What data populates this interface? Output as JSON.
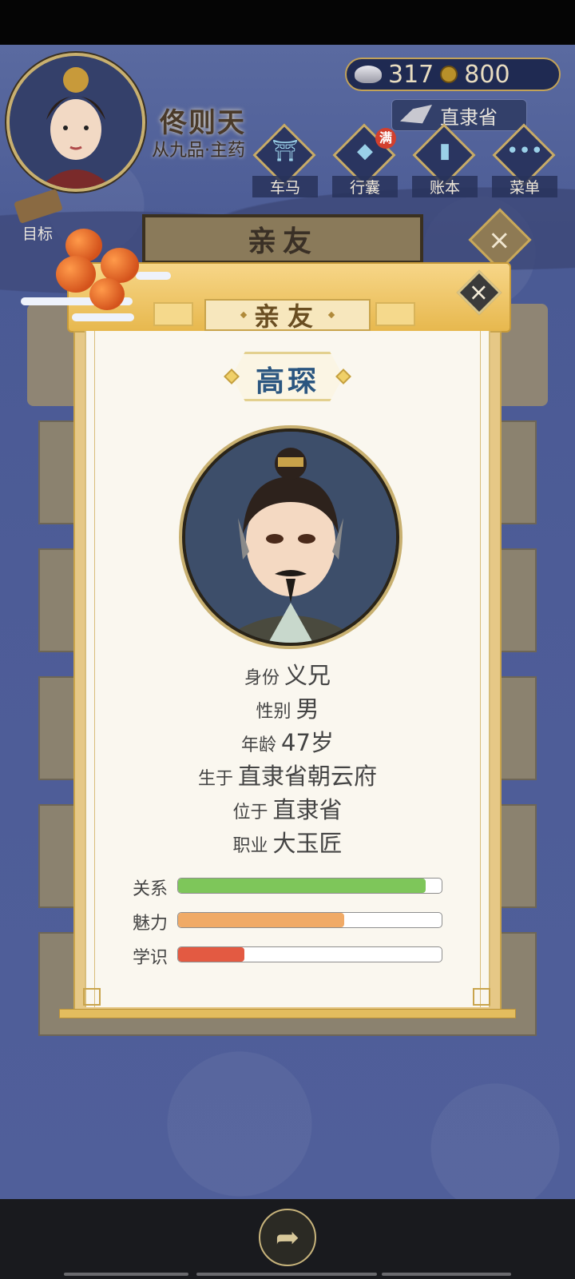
{
  "player": {
    "name": "佟则天",
    "rank": "从九品·主药"
  },
  "currency": {
    "silver": "317",
    "copper": "800"
  },
  "location": "直隶省",
  "nav": [
    {
      "label": "车马",
      "icon": "carriage-icon"
    },
    {
      "label": "行囊",
      "icon": "bag-icon",
      "badge": "满"
    },
    {
      "label": "账本",
      "icon": "ledger-icon"
    },
    {
      "label": "菜单",
      "icon": "menu-icon"
    }
  ],
  "goal_label": "目标",
  "section_title": "亲友",
  "popup": {
    "title": "亲友",
    "close_symbol": "×",
    "name": "高琛",
    "info": [
      {
        "key": "身份",
        "value": "义兄"
      },
      {
        "key": "性别",
        "value": "男"
      },
      {
        "key": "年龄",
        "value": "47岁"
      },
      {
        "key": "生于",
        "value": "直隶省朝云府"
      },
      {
        "key": "位于",
        "value": "直隶省"
      },
      {
        "key": "职业",
        "value": "大玉匠"
      }
    ],
    "stats": [
      {
        "key": "关系",
        "value": 0.94,
        "color": "#7ec65a"
      },
      {
        "key": "魅力",
        "value": 0.63,
        "color": "#f0aa66"
      },
      {
        "key": "学识",
        "value": 0.25,
        "color": "#e35a42"
      }
    ]
  }
}
